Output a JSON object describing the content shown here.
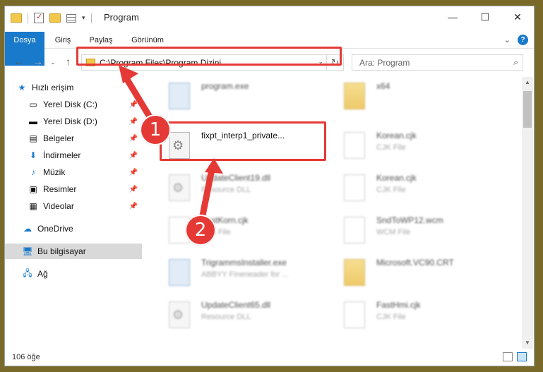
{
  "window": {
    "title": "Program"
  },
  "ribbon": {
    "tabs": [
      "Dosya",
      "Giriş",
      "Paylaş",
      "Görünüm"
    ]
  },
  "address": {
    "path": "C:\\Program Files\\Program Dizini"
  },
  "search": {
    "placeholder": "Ara: Program"
  },
  "sidebar": {
    "items": [
      {
        "label": "Hızlı erişim",
        "icon": "star-icon"
      },
      {
        "label": "Yerel Disk (C:)",
        "icon": "drive-icon"
      },
      {
        "label": "Yerel Disk (D:)",
        "icon": "drive-icon"
      },
      {
        "label": "Belgeler",
        "icon": "documents-icon"
      },
      {
        "label": "İndirmeler",
        "icon": "download-icon"
      },
      {
        "label": "Müzik",
        "icon": "music-icon"
      },
      {
        "label": "Resimler",
        "icon": "pictures-icon"
      },
      {
        "label": "Videolar",
        "icon": "video-icon"
      },
      {
        "label": "OneDrive",
        "icon": "cloud-icon"
      },
      {
        "label": "Bu bilgisayar",
        "icon": "computer-icon"
      },
      {
        "label": "Ağ",
        "icon": "network-icon"
      }
    ]
  },
  "files": [
    {
      "name": "program.exe",
      "type": ""
    },
    {
      "name": "x64",
      "type": ""
    },
    {
      "name": "fixpt_interp1_private...",
      "type": ""
    },
    {
      "name": "Korean.cjk",
      "type": "CJK File"
    },
    {
      "name": "UpdateClient19.dll",
      "type": "Resource DLL"
    },
    {
      "name": "Korean.cjk",
      "type": "CJK File"
    },
    {
      "name": "FirstKorn.cjk",
      "type": "CJK File"
    },
    {
      "name": "SndToWP12.wcm",
      "type": "WCM File"
    },
    {
      "name": "TrigrammsInstaller.exe",
      "type": "ABBYY Fineneader for ..."
    },
    {
      "name": "Microsoft.VC90.CRT",
      "type": ""
    },
    {
      "name": "UpdateClient65.dll",
      "type": "Resource DLL"
    },
    {
      "name": "FastHmi.cjk",
      "type": "CJK File"
    }
  ],
  "status": {
    "count": "106 öğe"
  },
  "annotations": {
    "badge1": "1",
    "badge2": "2"
  },
  "colors": {
    "accent": "#1979ca",
    "highlight": "#e53935"
  }
}
